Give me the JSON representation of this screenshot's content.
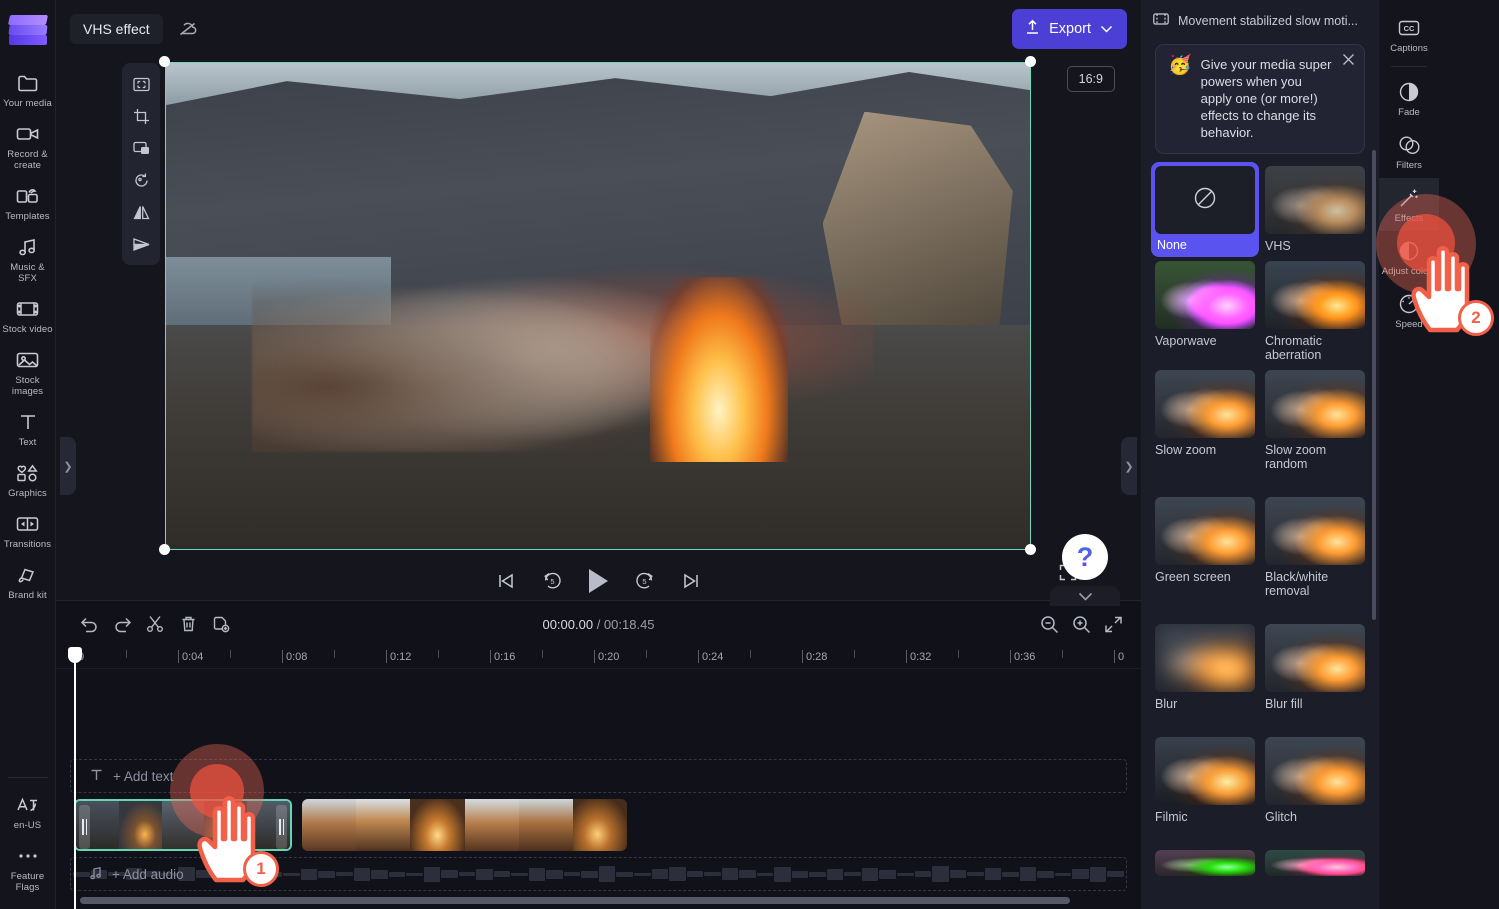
{
  "app": {
    "left_rail": {
      "logo_name": "clipchamp-logo",
      "items": [
        {
          "label": "Your media",
          "icon": "folder-icon"
        },
        {
          "label": "Record & create",
          "icon": "camera-icon"
        },
        {
          "label": "Templates",
          "icon": "templates-icon"
        },
        {
          "label": "Music & SFX",
          "icon": "music-note-icon"
        },
        {
          "label": "Stock video",
          "icon": "film-icon"
        },
        {
          "label": "Stock images",
          "icon": "image-icon"
        },
        {
          "label": "Text",
          "icon": "text-icon"
        },
        {
          "label": "Graphics",
          "icon": "graphics-icon"
        },
        {
          "label": "Transitions",
          "icon": "transitions-icon"
        },
        {
          "label": "Brand kit",
          "icon": "brand-kit-icon"
        }
      ],
      "bottom_items": [
        {
          "label": "en-US",
          "icon": "language-icon"
        },
        {
          "label": "Feature Flags",
          "icon": "ellipsis-icon"
        }
      ]
    },
    "topbar": {
      "project_title": "VHS effect",
      "cloud_icon": "cloud-off-icon",
      "export_label": "Export",
      "export_icon": "upload-icon",
      "export_chevron": "chevron-down-icon"
    },
    "preview": {
      "float_tools": [
        {
          "icon": "fit-to-screen-icon"
        },
        {
          "icon": "crop-icon"
        },
        {
          "icon": "picture-in-picture-icon"
        },
        {
          "icon": "rotate-icon"
        },
        {
          "icon": "flip-horizontal-icon"
        },
        {
          "icon": "flip-vertical-icon"
        }
      ],
      "aspect_ratio": "16:9",
      "playback": [
        {
          "icon": "skip-to-start-icon"
        },
        {
          "icon": "rewind-5-icon"
        },
        {
          "icon": "play-icon"
        },
        {
          "icon": "forward-5-icon"
        },
        {
          "icon": "skip-to-end-icon"
        }
      ],
      "fullscreen_icon": "fullscreen-icon",
      "help_label": "?",
      "collapse_icon": "chevron-down-icon"
    },
    "timeline": {
      "tools": [
        {
          "icon": "undo-icon"
        },
        {
          "icon": "redo-icon"
        },
        {
          "icon": "scissors-icon"
        },
        {
          "icon": "trash-icon"
        },
        {
          "icon": "duplicate-icon"
        }
      ],
      "current_time": "00:00.00",
      "total_time": "/ 00:18.45",
      "zoom_tools": [
        {
          "icon": "zoom-out-icon"
        },
        {
          "icon": "zoom-in-icon"
        },
        {
          "icon": "fit-timeline-icon"
        }
      ],
      "ruler_labels": [
        "0",
        "0:04",
        "0:08",
        "0:12",
        "0:16",
        "0:20",
        "0:24",
        "0:28",
        "0:32",
        "0:36",
        "0"
      ],
      "text_track_label": "+ Add text",
      "text_track_icon": "text-icon",
      "audio_track_label": "+ Add audio",
      "audio_track_icon": "music-note-icon"
    },
    "effects_panel": {
      "media_name": "Movement stabilized slow moti...",
      "media_icon": "video-clip-icon",
      "tip": {
        "emoji": "🥳",
        "text": "Give your media super powers when you apply one (or more!) effects to change its behavior.",
        "close_icon": "close-icon"
      },
      "selected_effect": "None",
      "none_icon": "no-effect-icon",
      "effects": [
        {
          "label": "None",
          "selected": true,
          "style": "none"
        },
        {
          "label": "VHS",
          "selected": false,
          "style": "vhs"
        },
        {
          "label": "Vaporwave",
          "selected": false,
          "style": "vaporwave"
        },
        {
          "label": "Chromatic aberration",
          "selected": false,
          "style": "chromatic"
        },
        {
          "label": "Slow zoom",
          "selected": false,
          "style": "plain"
        },
        {
          "label": "Slow zoom random",
          "selected": false,
          "style": "plain"
        },
        {
          "label": "Green screen",
          "selected": false,
          "style": "plain"
        },
        {
          "label": "Black/white removal",
          "selected": false,
          "style": "plain"
        },
        {
          "label": "Blur",
          "selected": false,
          "style": "blur"
        },
        {
          "label": "Blur fill",
          "selected": false,
          "style": "plain"
        },
        {
          "label": "Filmic",
          "selected": false,
          "style": "plain"
        },
        {
          "label": "Glitch",
          "selected": false,
          "style": "plain"
        },
        {
          "label": "",
          "selected": false,
          "style": "green"
        },
        {
          "label": "",
          "selected": false,
          "style": "pink"
        }
      ]
    },
    "right_rail": {
      "items": [
        {
          "label": "Captions",
          "icon": "closed-captions-icon",
          "active": false
        },
        {
          "label": "Fade",
          "icon": "fade-icon",
          "active": false
        },
        {
          "label": "Filters",
          "icon": "filters-icon",
          "active": false
        },
        {
          "label": "Effects",
          "icon": "magic-wand-icon",
          "active": true
        },
        {
          "label": "Adjust colors",
          "icon": "adjust-colors-icon",
          "active": false
        },
        {
          "label": "Speed",
          "icon": "speedometer-icon",
          "active": false
        }
      ]
    },
    "annotations": {
      "step_1": "1",
      "step_2": "2"
    },
    "colors": {
      "accent_purple": "#4b3fd6",
      "selection_purple": "#5b53f0",
      "clip_selected_border": "#63d6b4",
      "marker_red": "#f2604a",
      "panel_bg": "#1b1d28",
      "app_bg": "#15161d"
    }
  }
}
